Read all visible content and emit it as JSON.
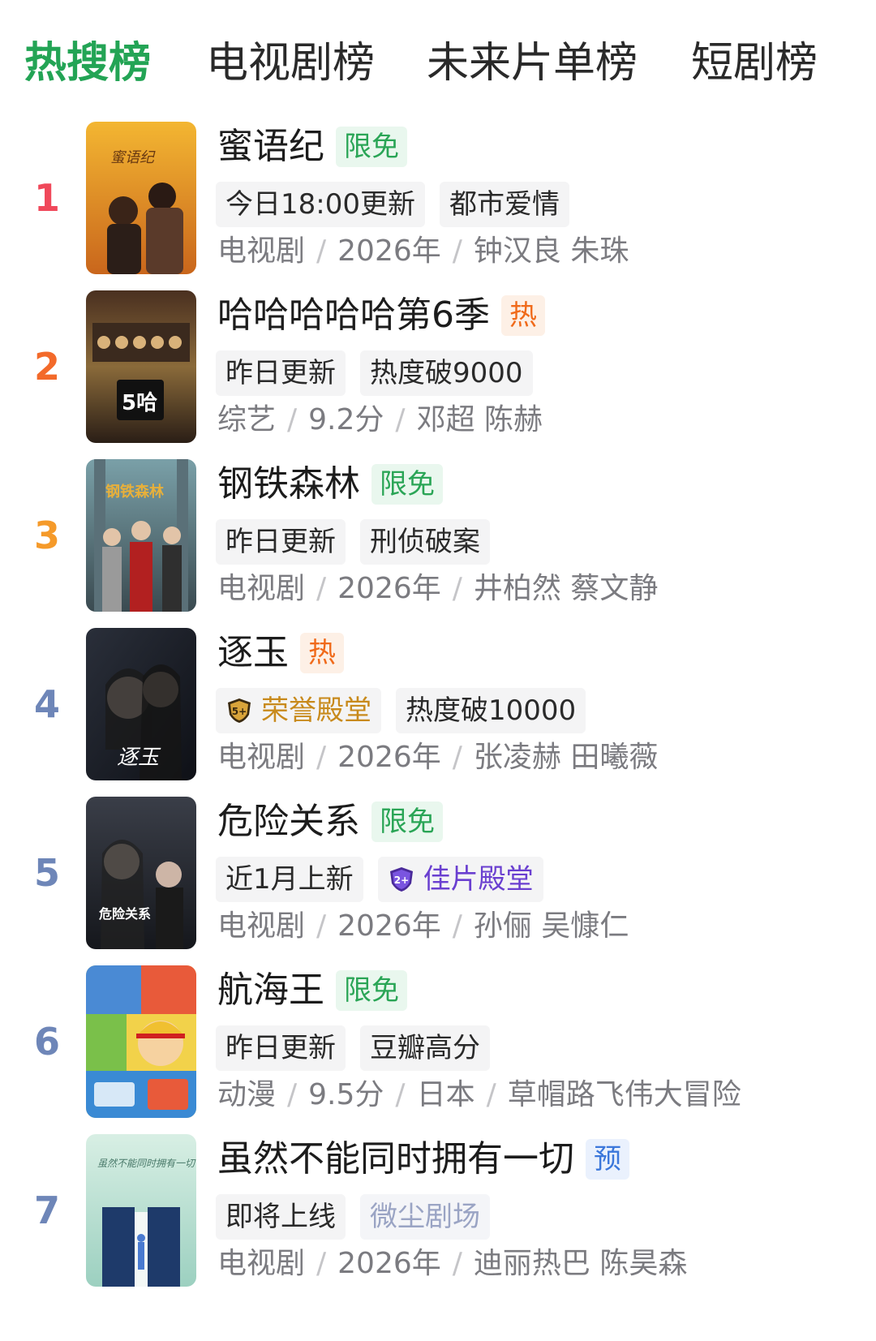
{
  "tabs": [
    {
      "label": "热搜榜",
      "active": true
    },
    {
      "label": "电视剧榜",
      "active": false
    },
    {
      "label": "未来片单榜",
      "active": false
    },
    {
      "label": "短剧榜",
      "active": false
    },
    {
      "label": "",
      "active": false
    }
  ],
  "colors": {
    "accent": "#23a455",
    "rank1": "#f0485a",
    "rank2": "#f36a2a",
    "rank3": "#f59a2a",
    "rank_other": "#6e86b8"
  },
  "items": [
    {
      "rank": "1",
      "title": "蜜语纪",
      "tag": "限免",
      "chips": [
        "今日18:00更新",
        "都市爱情"
      ],
      "meta": [
        "电视剧",
        "2026年"
      ],
      "cast": "钟汉良 朱珠",
      "poster_text": "蜜语纪"
    },
    {
      "rank": "2",
      "title": "哈哈哈哈哈第6季",
      "tag": "热",
      "chips": [
        "昨日更新",
        "热度破9000"
      ],
      "meta": [
        "综艺",
        "9.2分"
      ],
      "cast": "邓超 陈赫",
      "poster_text": "5哈"
    },
    {
      "rank": "3",
      "title": "钢铁森林",
      "tag": "限免",
      "chips": [
        "昨日更新",
        "刑侦破案"
      ],
      "meta": [
        "电视剧",
        "2026年"
      ],
      "cast": "井柏然 蔡文静",
      "poster_text": "钢铁森林"
    },
    {
      "rank": "4",
      "title": "逐玉",
      "tag": "热",
      "chips": [
        "荣誉殿堂",
        "热度破10000"
      ],
      "chip_badge": "5+",
      "meta": [
        "电视剧",
        "2026年"
      ],
      "cast": "张凌赫 田曦薇",
      "poster_text": "逐玉"
    },
    {
      "rank": "5",
      "title": "危险关系",
      "tag": "限免",
      "chips": [
        "近1月上新",
        "佳片殿堂"
      ],
      "chip_badge": "2+",
      "meta": [
        "电视剧",
        "2026年"
      ],
      "cast": "孙俪 吴慷仁",
      "poster_text": "危险关系"
    },
    {
      "rank": "6",
      "title": "航海王",
      "tag": "限免",
      "chips": [
        "昨日更新",
        "豆瓣高分"
      ],
      "meta": [
        "动漫",
        "9.5分",
        "日本"
      ],
      "cast": "草帽路飞伟大冒险",
      "poster_text": ""
    },
    {
      "rank": "7",
      "title": "虽然不能同时拥有一切",
      "tag": "预",
      "chips": [
        "即将上线",
        "微尘剧场"
      ],
      "meta": [
        "电视剧",
        "2026年"
      ],
      "cast": "迪丽热巴 陈昊森",
      "poster_text": "虽然不能同时拥有一切"
    }
  ]
}
